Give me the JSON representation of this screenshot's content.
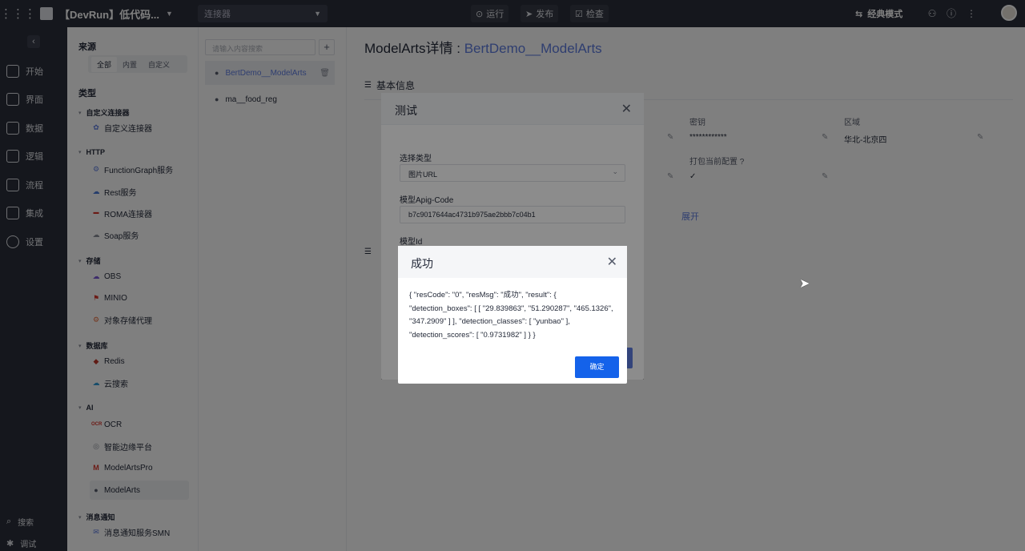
{
  "topbar": {
    "project_name": "【DevRun】低代码...",
    "connector_select": "连接器",
    "run": "运行",
    "publish": "发布",
    "check": "检查",
    "mode": "经典模式"
  },
  "leftnav": {
    "items": [
      "开始",
      "界面",
      "数据",
      "逻辑",
      "流程",
      "集成",
      "设置"
    ],
    "bottom": [
      "搜索",
      "调试"
    ]
  },
  "sidebar": {
    "source_title": "来源",
    "source_tabs": [
      "全部",
      "内置",
      "自定义"
    ],
    "type_title": "类型",
    "groups": [
      {
        "name": "自定义连接器",
        "items": [
          "自定义连接器"
        ]
      },
      {
        "name": "HTTP",
        "items": [
          "FunctionGraph服务",
          "Rest服务",
          "ROMA连接器",
          "Soap服务"
        ]
      },
      {
        "name": "存储",
        "items": [
          "OBS",
          "MINIO",
          "对象存储代理"
        ]
      },
      {
        "name": "数据库",
        "items": [
          "Redis",
          "云搜索"
        ]
      },
      {
        "name": "AI",
        "items": [
          "OCR",
          "智能边缘平台",
          "ModelArtsPro",
          "ModelArts"
        ]
      },
      {
        "name": "消息通知",
        "items": [
          "消息通知服务SMN"
        ]
      }
    ]
  },
  "list": {
    "search_placeholder": "请输入内容搜索",
    "items": [
      "BertDemo__ModelArts",
      "ma__food_reg"
    ]
  },
  "main": {
    "title_prefix": "ModelArts详情 : ",
    "title_name": "BertDemo__ModelArts",
    "basic_info": "基本信息",
    "secret_label": "密钥",
    "secret_value": "************",
    "region_label": "区域",
    "region_value": "华北-北京四",
    "package_label": "打包当前配置",
    "expand": "展开"
  },
  "test_dialog": {
    "title": "测试",
    "type_label": "选择类型",
    "type_value": "图片URL",
    "apig_label": "模型Apig-Code",
    "apig_value": "b7c9017644ac4731b975ae2bbb7c04b1",
    "model_id_label": "模型Id"
  },
  "success_dialog": {
    "title": "成功",
    "body": "{ \"resCode\": \"0\", \"resMsg\": \"成功\", \"result\": { \"detection_boxes\": [ [ \"29.839863\", \"51.290287\", \"465.1326\", \"347.2909\" ] ], \"detection_classes\": [ \"yunbao\" ], \"detection_scores\": [ \"0.9731982\" ] } }",
    "ok": "确定"
  }
}
